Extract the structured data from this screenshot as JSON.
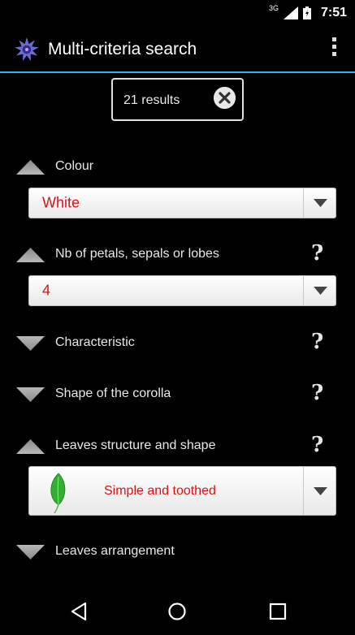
{
  "status_bar": {
    "network": "3G",
    "time": "7:51"
  },
  "action_bar": {
    "title": "Multi-criteria search",
    "logo_icon": "cornflower-logo-icon",
    "menu_icon": "overflow-menu-icon"
  },
  "results": {
    "label": "21 results",
    "clear_icon": "close-circle-icon"
  },
  "sections": {
    "colour": {
      "label": "Colour",
      "expanded": true,
      "selected": "White"
    },
    "petals": {
      "label": "Nb of petals, sepals or lobes",
      "expanded": true,
      "help": "?",
      "selected": "4"
    },
    "characteristic": {
      "label": "Characteristic",
      "expanded": false,
      "help": "?"
    },
    "corolla": {
      "label": "Shape of the corolla",
      "expanded": false,
      "help": "?"
    },
    "leaves_structure": {
      "label": "Leaves structure and shape",
      "expanded": true,
      "help": "?",
      "selected": "Simple and toothed",
      "selected_icon": "leaf-icon"
    },
    "leaves_arrangement": {
      "label": "Leaves arrangement",
      "expanded": false
    }
  },
  "colors": {
    "accent": "#33b5e5",
    "selected_text": "#e01010",
    "background": "#000000"
  },
  "nav": {
    "back_icon": "back-icon",
    "home_icon": "home-icon",
    "recents_icon": "recents-icon"
  }
}
